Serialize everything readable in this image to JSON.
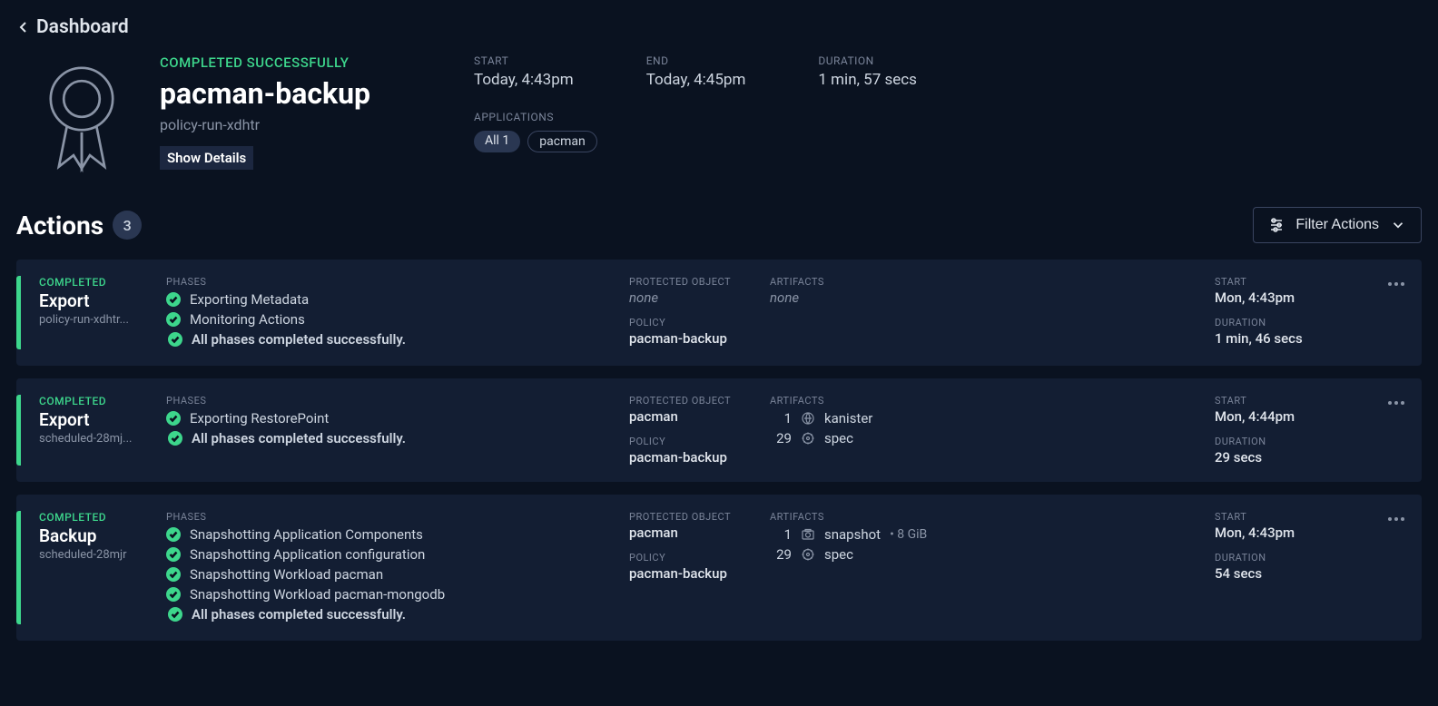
{
  "back_label": "Dashboard",
  "header": {
    "status": "COMPLETED SUCCESSFULLY",
    "title": "pacman-backup",
    "subtitle": "policy-run-xdhtr",
    "show_details": "Show Details",
    "start_label": "START",
    "start_value": "Today, 4:43pm",
    "end_label": "END",
    "end_value": "Today, 4:45pm",
    "duration_label": "DURATION",
    "duration_value": "1 min, 57 secs",
    "applications_label": "APPLICATIONS",
    "app_all": "All 1",
    "app_name": "pacman"
  },
  "actions": {
    "title": "Actions",
    "count": "3",
    "filter_label": "Filter Actions"
  },
  "labels": {
    "phases": "PHASES",
    "protected_object": "PROTECTED OBJECT",
    "artifacts": "ARTIFACTS",
    "policy": "POLICY",
    "start": "START",
    "duration": "DURATION",
    "completed": "COMPLETED",
    "all_phases": "All phases completed successfully.",
    "none": "none"
  },
  "cards": [
    {
      "name": "Export",
      "sub": "policy-run-xdhtr...",
      "phases": [
        "Exporting Metadata",
        "Monitoring Actions"
      ],
      "protected_object": null,
      "policy": "pacman-backup",
      "artifacts_none": true,
      "artifacts": [],
      "start": "Mon, 4:43pm",
      "duration": "1 min, 46 secs"
    },
    {
      "name": "Export",
      "sub": "scheduled-28mj...",
      "phases": [
        "Exporting RestorePoint"
      ],
      "protected_object": "pacman",
      "policy": "pacman-backup",
      "artifacts_none": false,
      "artifacts": [
        {
          "count": "1",
          "icon": "kanister",
          "name": "kanister",
          "size": ""
        },
        {
          "count": "29",
          "icon": "spec",
          "name": "spec",
          "size": ""
        }
      ],
      "start": "Mon, 4:44pm",
      "duration": "29 secs"
    },
    {
      "name": "Backup",
      "sub": "scheduled-28mjr",
      "phases": [
        "Snapshotting Application Components",
        "Snapshotting Application configuration",
        "Snapshotting Workload pacman",
        "Snapshotting Workload pacman-mongodb"
      ],
      "protected_object": "pacman",
      "policy": "pacman-backup",
      "artifacts_none": false,
      "artifacts": [
        {
          "count": "1",
          "icon": "snapshot",
          "name": "snapshot",
          "size": "• 8 GiB"
        },
        {
          "count": "29",
          "icon": "spec",
          "name": "spec",
          "size": ""
        }
      ],
      "start": "Mon, 4:43pm",
      "duration": "54 secs"
    }
  ]
}
